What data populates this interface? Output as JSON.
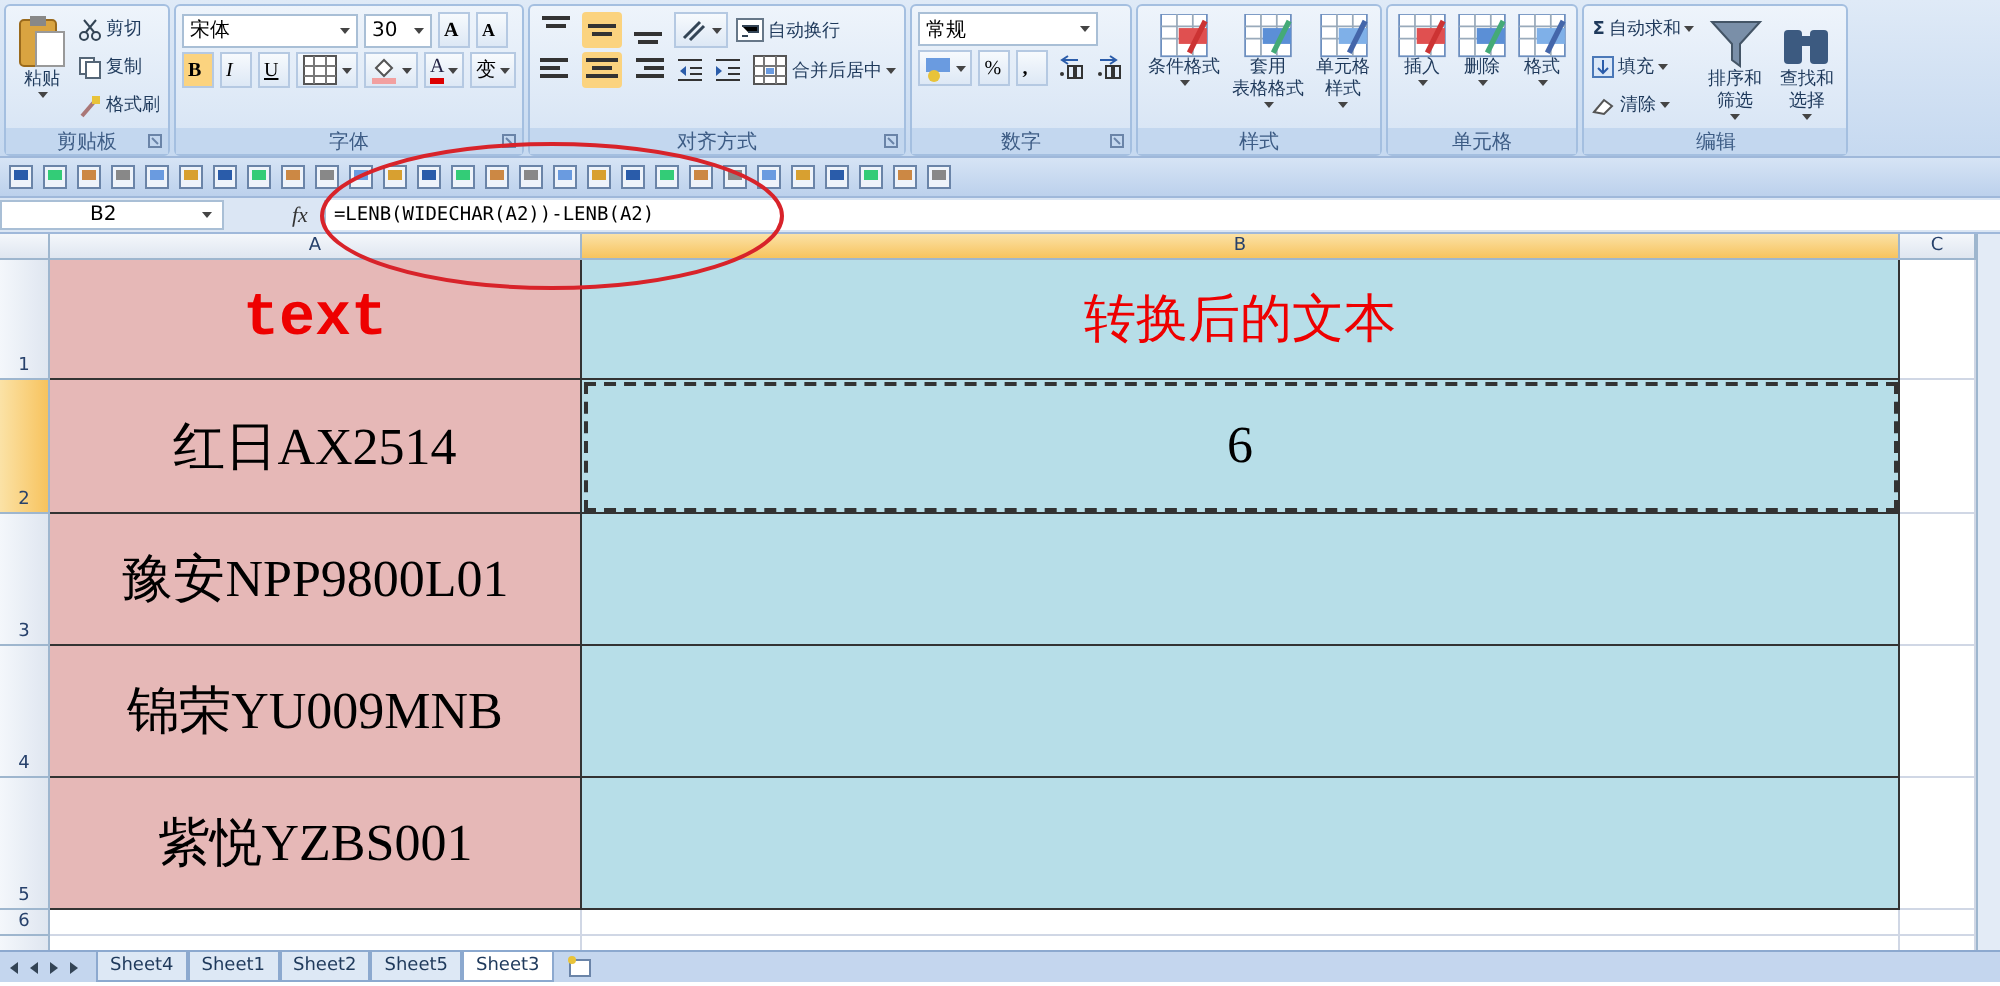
{
  "ribbon": {
    "groups": [
      {
        "kind": "clipboard",
        "label": "剪贴板",
        "launcher": true,
        "paste": "粘贴",
        "items": [
          "剪切",
          "复制",
          "格式刷"
        ]
      },
      {
        "kind": "font",
        "label": "字体",
        "launcher": true,
        "font": "宋体",
        "size": "30",
        "grow": "A",
        "shrink": "A",
        "styles": [
          {
            "label": "B",
            "selected": true
          },
          {
            "label": "I",
            "selected": false
          },
          {
            "label": "U",
            "selected": false
          }
        ],
        "color_label": "A",
        "phonetic": "变"
      },
      {
        "kind": "alignment",
        "label": "对齐方式",
        "launcher": true,
        "vertical": [
          {
            "selected": false
          },
          {
            "selected": true
          },
          {
            "selected": false
          }
        ],
        "horizontal": [
          {
            "selected": false
          },
          {
            "selected": true
          },
          {
            "selected": false
          }
        ],
        "wrap": "自动换行",
        "merge": "合并后居中"
      },
      {
        "kind": "number",
        "label": "数字",
        "launcher": true,
        "format": "常规",
        "percent": "%",
        "comma": ","
      },
      {
        "kind": "large",
        "label": "样式",
        "launcher": false,
        "buttons": [
          {
            "lines": [
              "条件格式"
            ]
          },
          {
            "lines": [
              "套用",
              "表格格式"
            ]
          },
          {
            "lines": [
              "单元格",
              "样式"
            ]
          }
        ]
      },
      {
        "kind": "large",
        "label": "单元格",
        "launcher": false,
        "buttons": [
          {
            "lines": [
              "插入"
            ]
          },
          {
            "lines": [
              "删除"
            ]
          },
          {
            "lines": [
              "格式"
            ]
          }
        ]
      },
      {
        "kind": "editing",
        "label": "编辑",
        "launcher": false,
        "sigma": "Σ",
        "items": [
          "自动求和",
          "填充",
          "清除"
        ],
        "buttons": [
          {
            "lines": [
              "排序和",
              "筛选"
            ]
          },
          {
            "lines": [
              "查找和",
              "选择"
            ]
          }
        ]
      }
    ]
  },
  "formula_bar": {
    "name_box": "B2",
    "fx": "fx",
    "formula": "=LENB(WIDECHAR(A2))-LENB(A2)"
  },
  "annotation": {
    "kind": "ellipse"
  },
  "columns": [
    {
      "label": "A",
      "selected": false
    },
    {
      "label": "B",
      "selected": true
    },
    {
      "label": "C",
      "selected": false
    }
  ],
  "rows": [
    {
      "label": "1",
      "kind": "title",
      "selected": false,
      "cells": [
        {
          "text": "text",
          "color": "#e6b8b7",
          "selected": false
        },
        {
          "text": "转换后的文本",
          "color": "#b7dee8",
          "selected": false
        }
      ]
    },
    {
      "label": "2",
      "kind": "data",
      "selected": true,
      "cells": [
        {
          "text": "红日AX2514",
          "color": "#e6b8b7",
          "selected": false
        },
        {
          "text": "6",
          "color": "#b7dee8",
          "selected": true
        }
      ]
    },
    {
      "label": "3",
      "kind": "data",
      "selected": false,
      "cells": [
        {
          "text": "豫安NPP9800L01",
          "color": "#e6b8b7",
          "selected": false
        },
        {
          "text": "",
          "color": "#b7dee8",
          "selected": false
        }
      ]
    },
    {
      "label": "4",
      "kind": "data",
      "selected": false,
      "cells": [
        {
          "text": "锦荣YU009MNB",
          "color": "#e6b8b7",
          "selected": false
        },
        {
          "text": "",
          "color": "#b7dee8",
          "selected": false
        }
      ]
    },
    {
      "label": "5",
      "kind": "data",
      "selected": false,
      "cells": [
        {
          "text": "紫悦YZBS001",
          "color": "#e6b8b7",
          "selected": false
        },
        {
          "text": "",
          "color": "#b7dee8",
          "selected": false
        }
      ]
    },
    {
      "label": "6",
      "kind": "empty",
      "selected": false,
      "cells": []
    }
  ],
  "sheet_tabs": [
    {
      "label": "Sheet4",
      "selected": false
    },
    {
      "label": "Sheet1",
      "selected": false
    },
    {
      "label": "Sheet2",
      "selected": false
    },
    {
      "label": "Sheet5",
      "selected": false
    },
    {
      "label": "Sheet3",
      "selected": true
    }
  ]
}
